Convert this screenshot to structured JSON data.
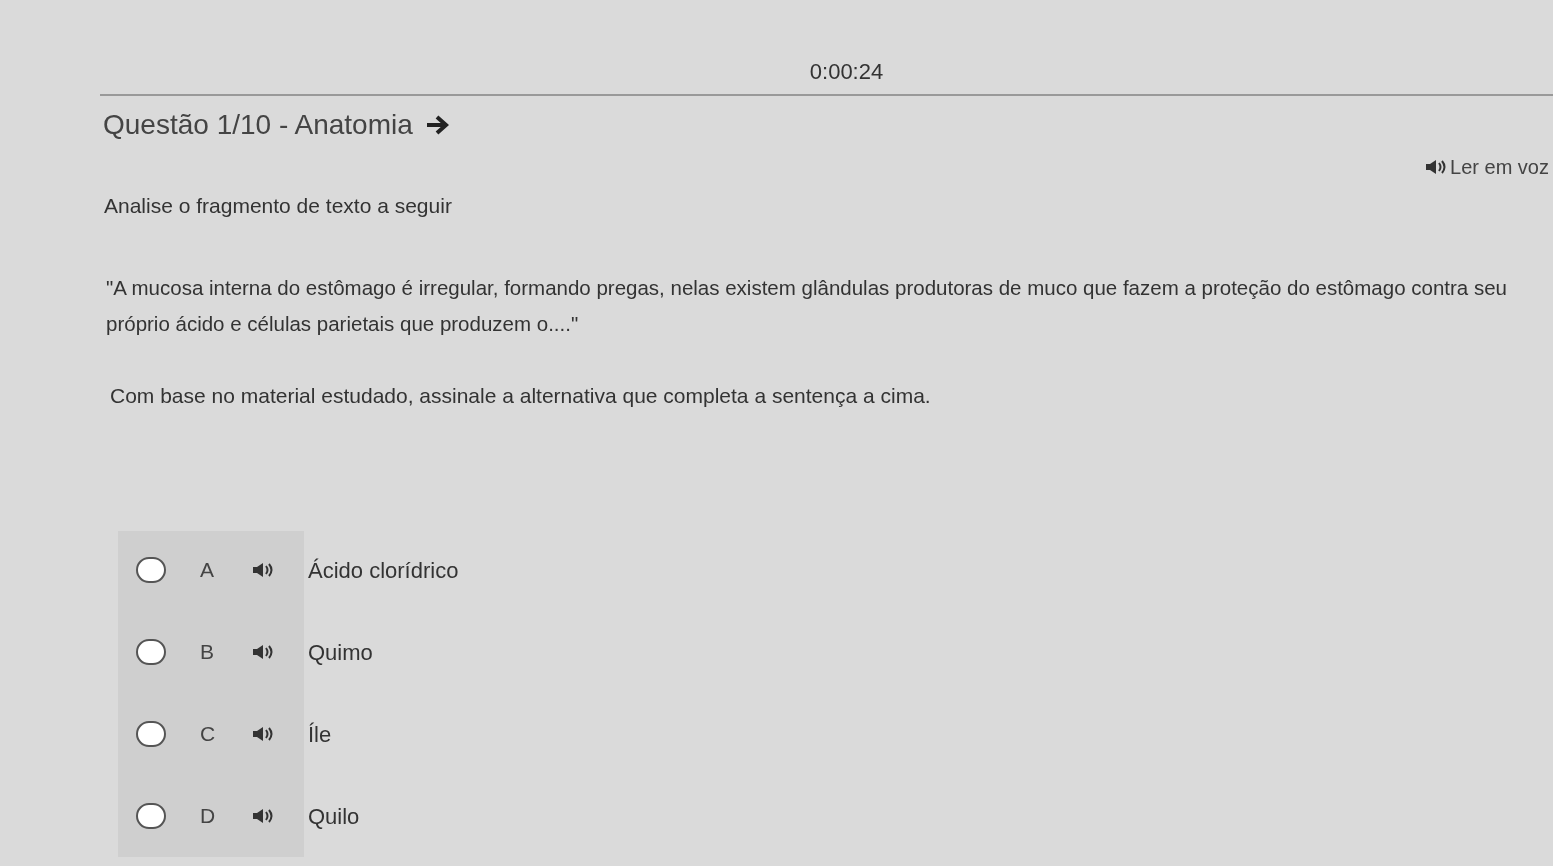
{
  "timer": "0:00:24",
  "question_title": "Questão 1/10 - Anatomia",
  "read_aloud": "Ler em voz",
  "intro": "Analise o fragmento de texto a seguir",
  "quote": "\"A mucosa interna do estômago é irregular, formando pregas, nelas existem glândulas produtoras de muco que fazem a proteção do estômago contra seu próprio ácido e células parietais que produzem o....\"",
  "instruction": "Com base no material estudado, assinale a alternativa que completa a sentença a cima.",
  "options": [
    {
      "letter": "A",
      "text": "Ácido clorídrico",
      "selected": false
    },
    {
      "letter": "B",
      "text": "Quimo",
      "selected": false
    },
    {
      "letter": "C",
      "text": "Íle",
      "selected": false
    },
    {
      "letter": "D",
      "text": "Quilo",
      "selected": false
    }
  ]
}
